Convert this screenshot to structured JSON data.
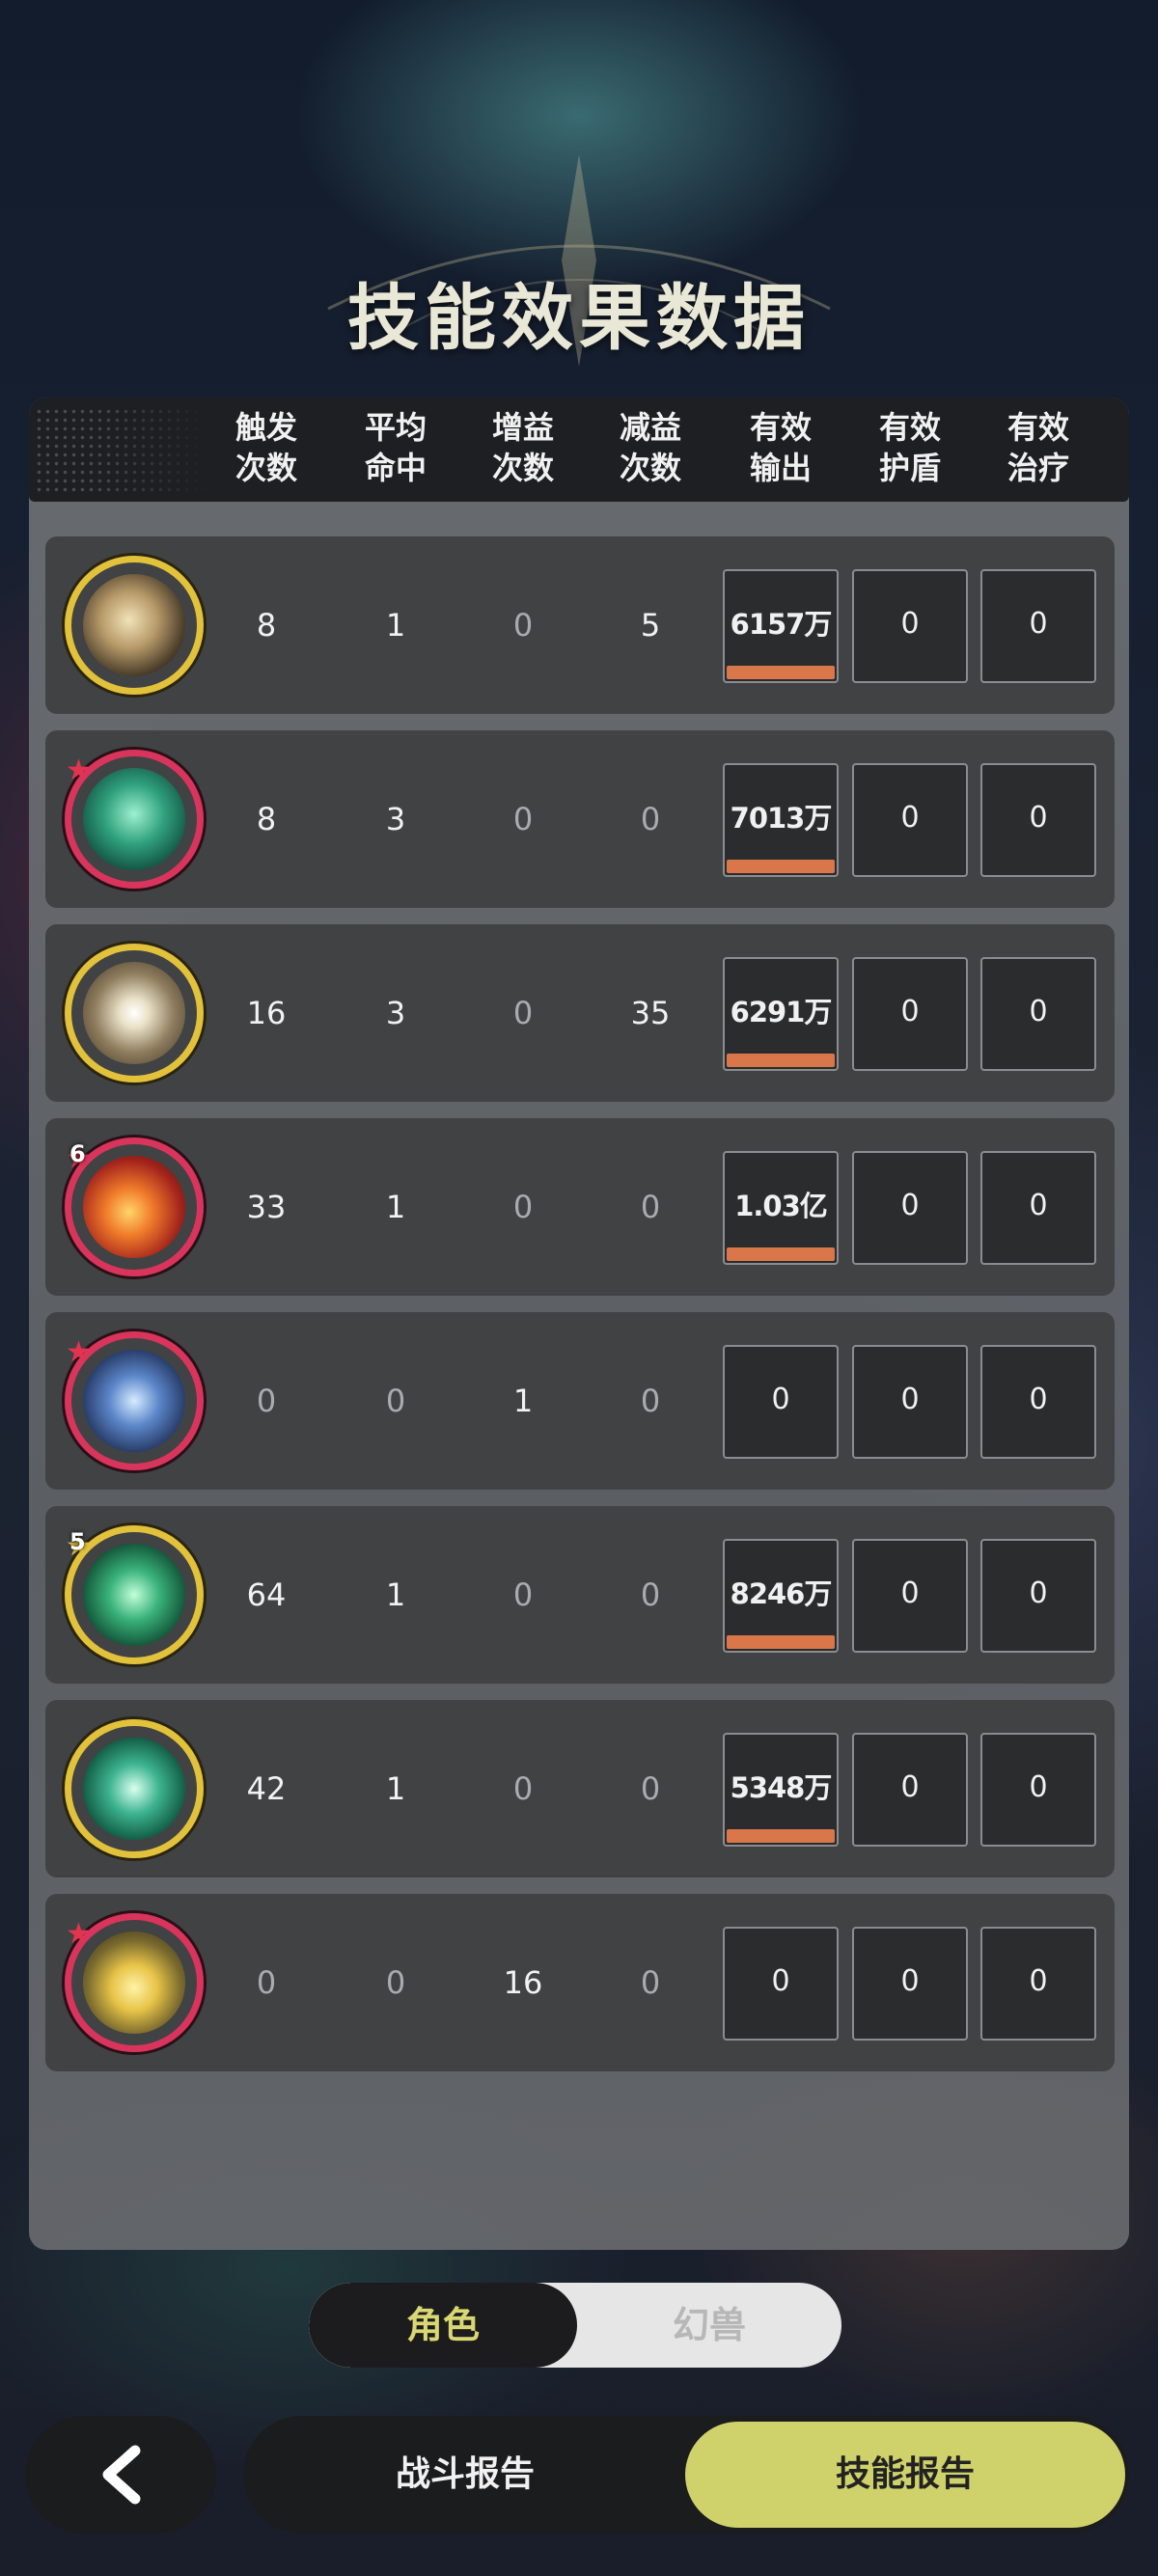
{
  "title": "技能效果数据",
  "columns": [
    {
      "l1": "触发",
      "l2": "次数"
    },
    {
      "l1": "平均",
      "l2": "命中"
    },
    {
      "l1": "增益",
      "l2": "次数"
    },
    {
      "l1": "减益",
      "l2": "次数"
    },
    {
      "l1": "有效",
      "l2": "输出"
    },
    {
      "l1": "有效",
      "l2": "护盾"
    },
    {
      "l1": "有效",
      "l2": "治疗"
    }
  ],
  "rows": [
    {
      "icon": "golden-claw-skill-icon",
      "frame": "gold",
      "badge": "",
      "trigger": "8",
      "hit": "1",
      "buff": "0",
      "debuff": "5",
      "damage": "6157万",
      "damage_fill": 1,
      "shield": "0",
      "heal": "0"
    },
    {
      "icon": "green-vortex-skill-icon",
      "frame": "red",
      "badge": "",
      "trigger": "8",
      "hit": "3",
      "buff": "0",
      "debuff": "0",
      "damage": "7013万",
      "damage_fill": 1,
      "shield": "0",
      "heal": "0"
    },
    {
      "icon": "lightning-star-skill-icon",
      "frame": "gold",
      "badge": "",
      "trigger": "16",
      "hit": "3",
      "buff": "0",
      "debuff": "35",
      "damage": "6291万",
      "damage_fill": 1,
      "shield": "0",
      "heal": "0"
    },
    {
      "icon": "fire-swirl-skill-icon",
      "frame": "red",
      "badge": "6",
      "trigger": "33",
      "hit": "1",
      "buff": "0",
      "debuff": "0",
      "damage": "1.03亿",
      "damage_fill": 1,
      "shield": "0",
      "heal": "0"
    },
    {
      "icon": "blue-crystal-skill-icon",
      "frame": "red",
      "badge": "",
      "trigger": "0",
      "hit": "0",
      "buff": "1",
      "debuff": "0",
      "damage": "0",
      "damage_fill": 0,
      "shield": "0",
      "heal": "0"
    },
    {
      "icon": "green-leaf-skill-icon",
      "frame": "gold",
      "badge": "5",
      "trigger": "64",
      "hit": "1",
      "buff": "0",
      "debuff": "0",
      "damage": "8246万",
      "damage_fill": 1,
      "shield": "0",
      "heal": "0"
    },
    {
      "icon": "green-arrows-skill-icon",
      "frame": "gold",
      "badge": "",
      "trigger": "42",
      "hit": "1",
      "buff": "0",
      "debuff": "0",
      "damage": "5348万",
      "damage_fill": 1,
      "shield": "0",
      "heal": "0"
    },
    {
      "icon": "yellow-spirit-skill-icon",
      "frame": "red",
      "badge": "",
      "trigger": "0",
      "hit": "0",
      "buff": "16",
      "debuff": "0",
      "damage": "0",
      "damage_fill": 0,
      "shield": "0",
      "heal": "0"
    }
  ],
  "toggle": {
    "active": "角色",
    "inactive": "幻兽"
  },
  "nav": {
    "left": "战斗报告",
    "right": "技能报告"
  },
  "colors": {
    "gold_frame": "#e2c23a",
    "red_frame": "#d9345c",
    "damage_bar": "#d9774a",
    "accent": "#cfd26a"
  }
}
